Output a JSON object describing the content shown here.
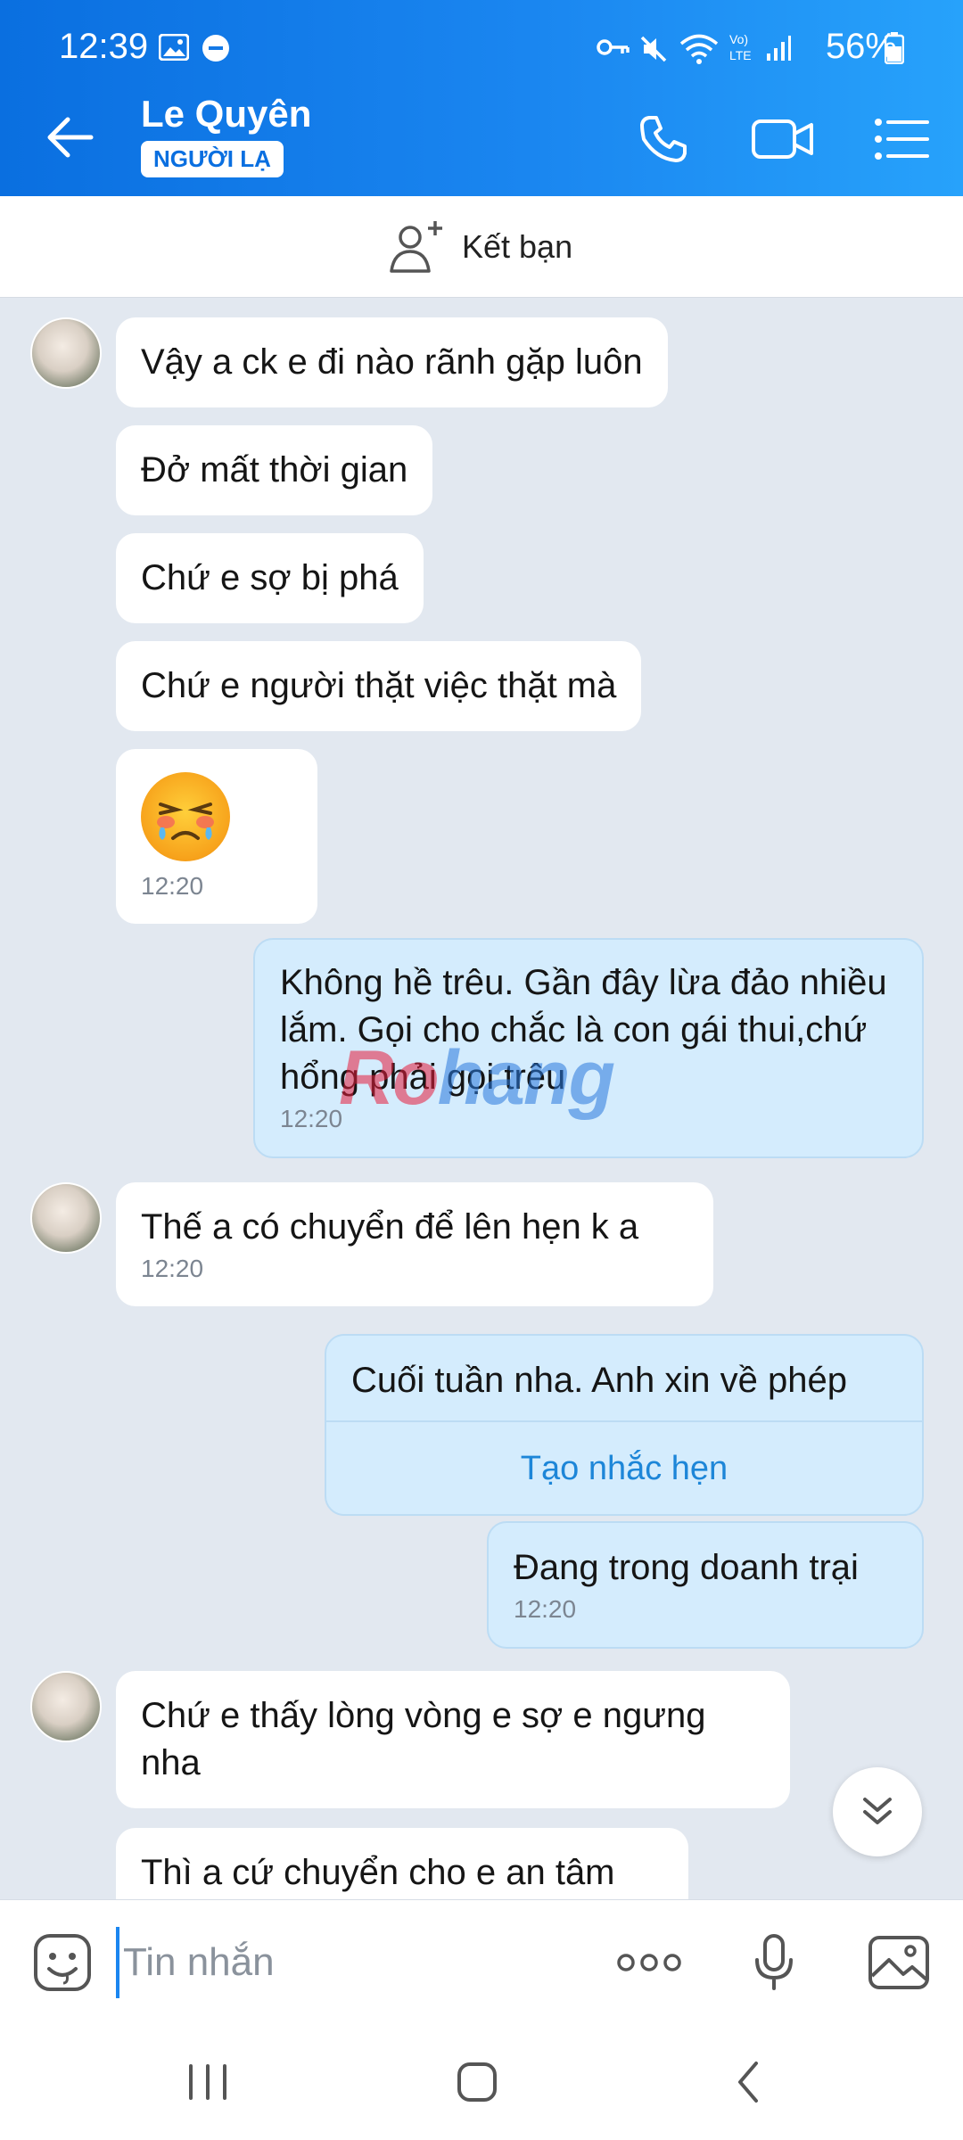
{
  "status_bar": {
    "time": "12:39",
    "battery": "56%"
  },
  "header": {
    "contact_name": "Le Quyên",
    "badge": "NGƯỜI LẠ"
  },
  "add_friend": {
    "label": "Kết bạn"
  },
  "messages": {
    "m1": "Vậy a ck e đi nào rãnh gặp luôn",
    "m2": "Đở mất thời gian",
    "m3": "Chứ e sợ bị phá",
    "m4": "Chứ e người thặt việc thặt mà",
    "m5_time": "12:20",
    "m6": "Không hề trêu. Gần đây lừa đảo nhiều lắm. Gọi cho chắc là con gái thui,chứ hổng phải gọi trêu",
    "m6_time": "12:20",
    "m7": "Thế a có chuyển để lên hẹn k a",
    "m7_time": "12:20",
    "m8": "Cuối tuần nha. Anh xin về phép",
    "m8_action": "Tạo nhắc hẹn",
    "m9": "Đang trong doanh trại",
    "m9_time": "12:20",
    "m10": "Chứ e thấy lòng vòng e sợ e ngưng nha",
    "m11": "Thì a cứ chuyển cho e an tâm"
  },
  "watermark": {
    "part1": "Ro",
    "part2": "hang"
  },
  "input": {
    "placeholder": "Tin nhắn"
  },
  "colors": {
    "header_start": "#0a6fe0",
    "header_end": "#27a2fb",
    "my_bubble": "#d4ecfd",
    "chat_bg": "#e2e8f0"
  }
}
